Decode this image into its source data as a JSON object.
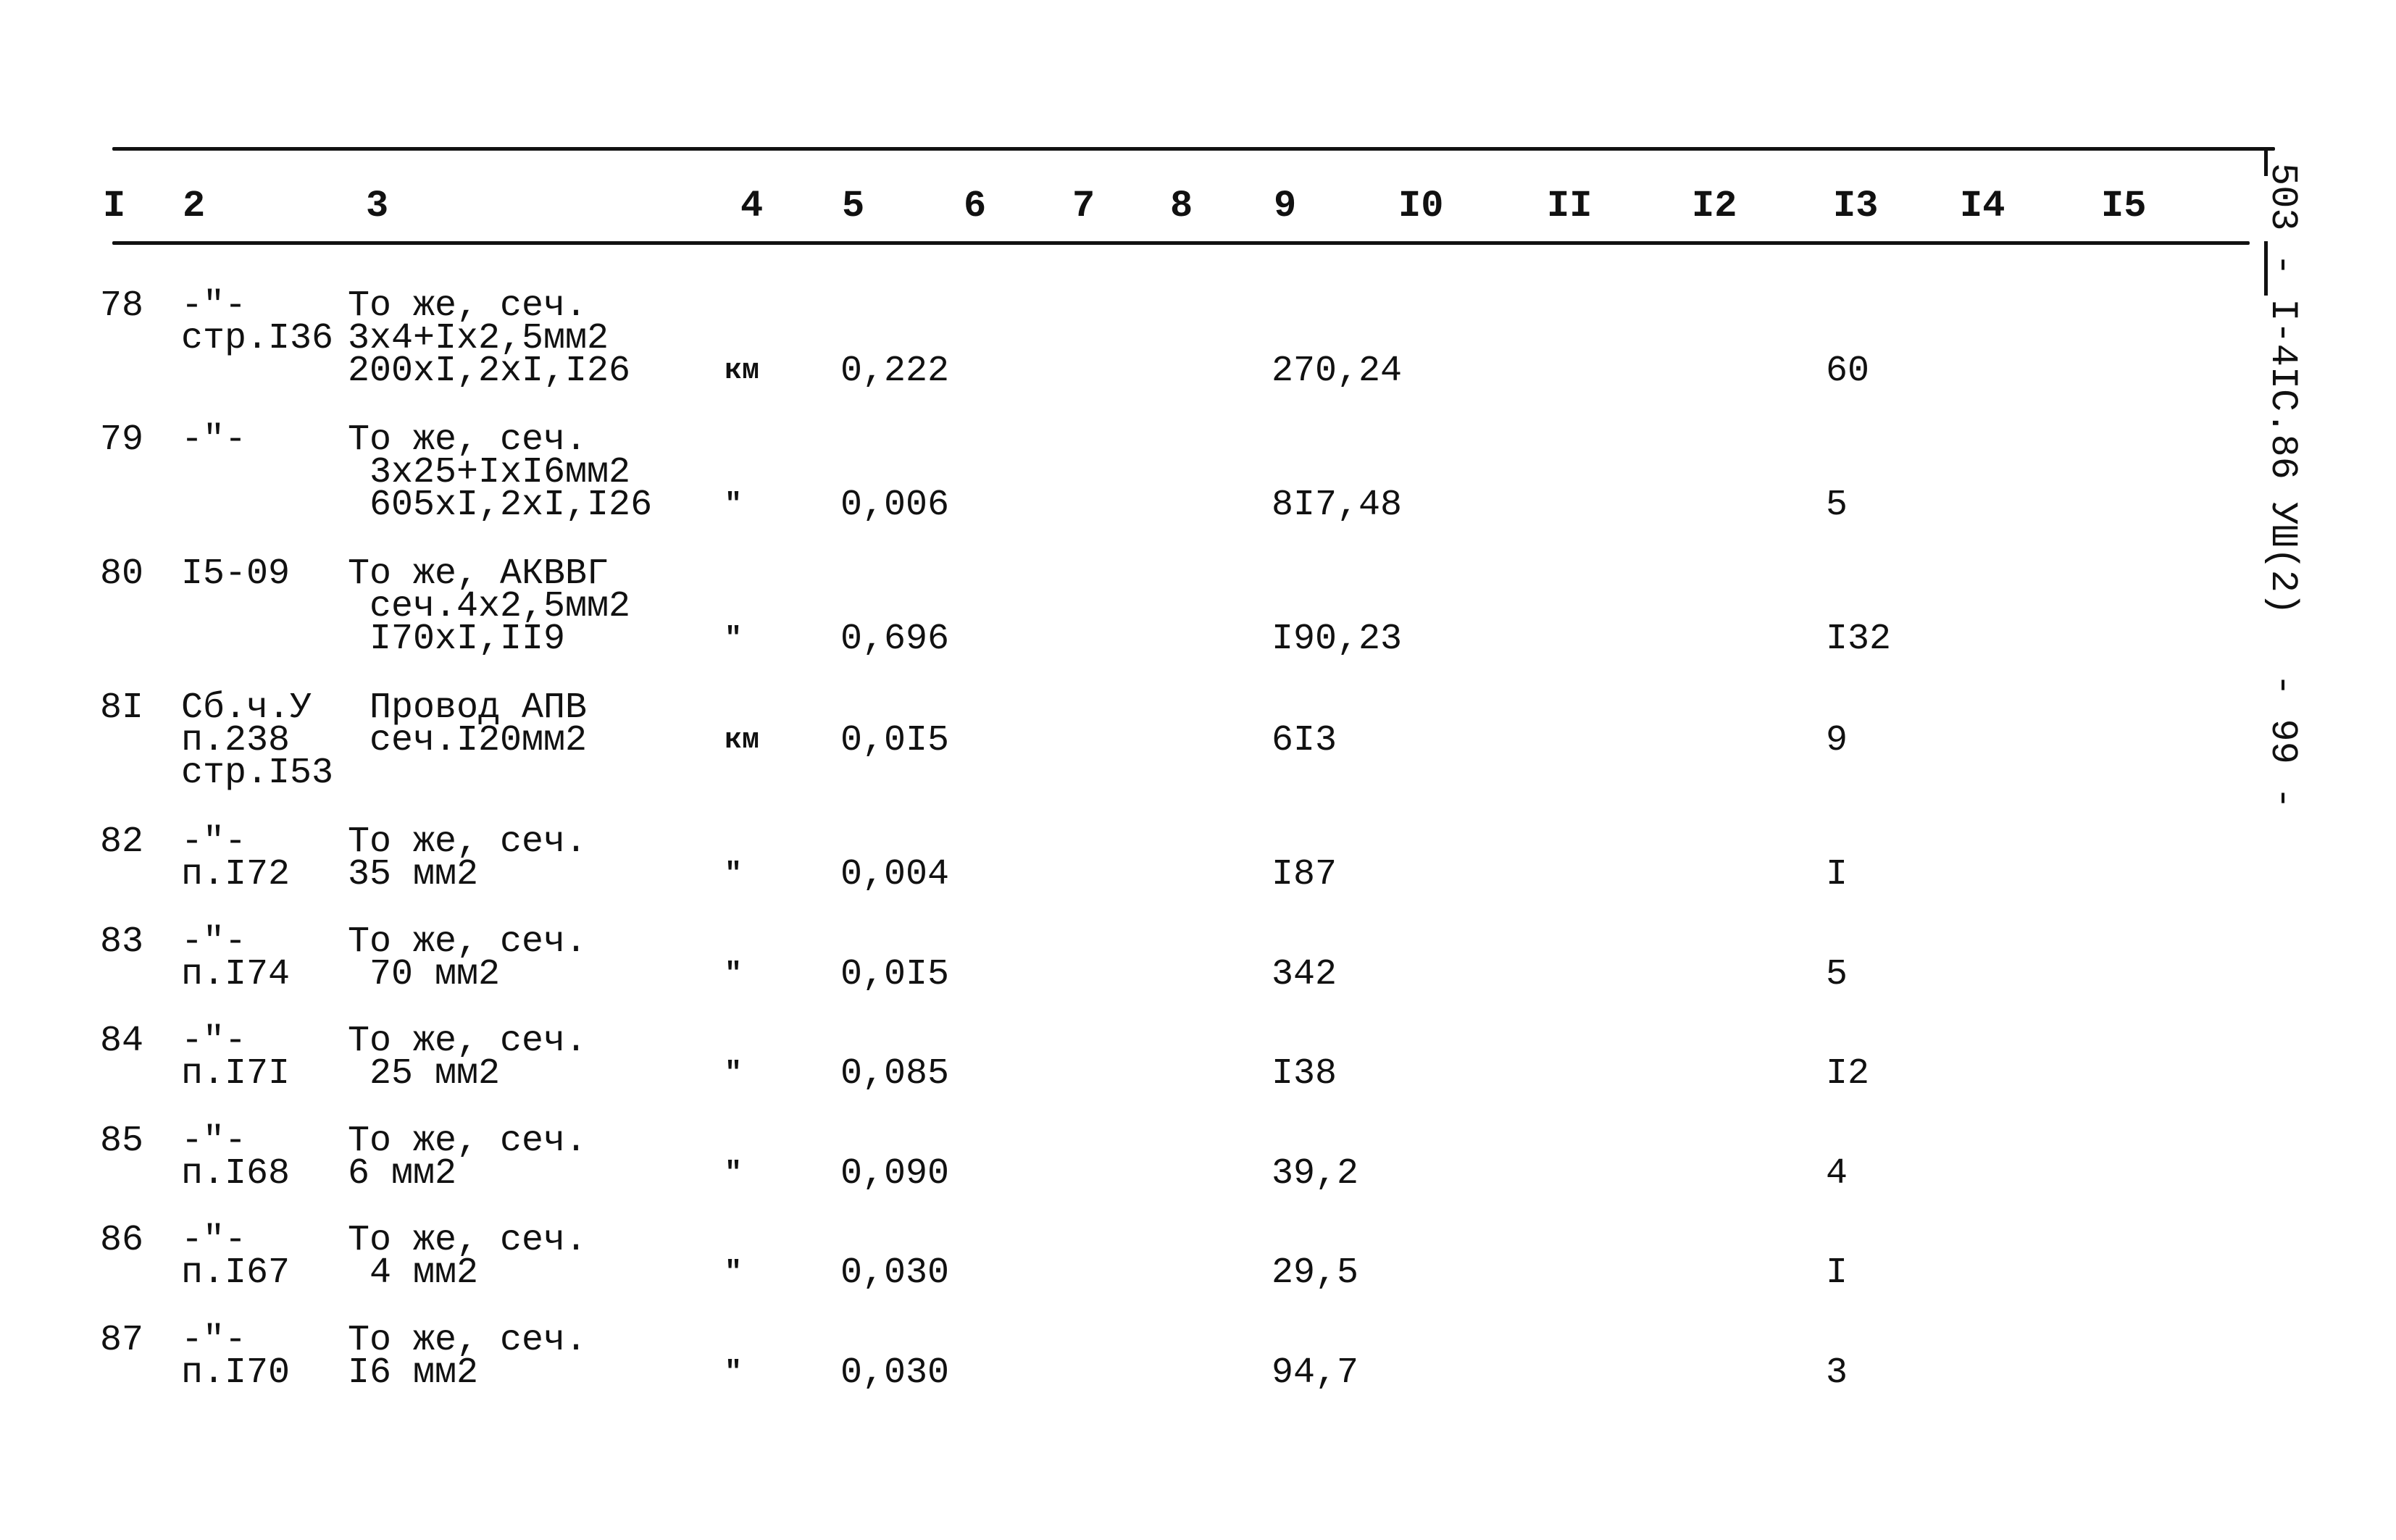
{
  "header": {
    "columns": [
      "I",
      "2",
      "3",
      "4",
      "5",
      "6",
      "7",
      "8",
      "9",
      "I0",
      "II",
      "I2",
      "I3",
      "I4",
      "I5"
    ]
  },
  "side_label": {
    "document_code": "503 - I-4IC.86 УШ(2)",
    "page_number": "- 99 -"
  },
  "rows": [
    {
      "num": "78",
      "ref": [
        "-\"-",
        "стр.I36"
      ],
      "desc": [
        "То же, сеч.",
        "3х4+Iх2,5мм2",
        "200хI,2хI,I26"
      ],
      "unit": "км",
      "qty": "0,222",
      "price": "270,24",
      "total": "60"
    },
    {
      "num": "79",
      "ref": [
        "-\"-"
      ],
      "desc": [
        "То же, сеч.",
        " 3х25+IхI6мм2",
        " 605хI,2хI,I26"
      ],
      "unit": "\"",
      "qty": "0,006",
      "price": "8I7,48",
      "total": "5"
    },
    {
      "num": "80",
      "ref": [
        "I5-09"
      ],
      "desc": [
        "То же, АКВВГ",
        " сеч.4х2,5мм2",
        " I70хI,II9"
      ],
      "unit": "\"",
      "qty": "0,696",
      "price": "I90,23",
      "total": "I32"
    },
    {
      "num": "8I",
      "ref": [
        "Сб.ч.У",
        "п.238",
        "стр.I53"
      ],
      "desc": [
        " Провод АПВ",
        " сеч.I20мм2"
      ],
      "unit": "км",
      "qty": "0,0I5",
      "price": "6I3",
      "total": "9"
    },
    {
      "num": "82",
      "ref": [
        "-\"-",
        "п.I72"
      ],
      "desc": [
        "То же, сеч.",
        "35 мм2"
      ],
      "unit": "\"",
      "qty": "0,004",
      "price": "I87",
      "total": "I"
    },
    {
      "num": "83",
      "ref": [
        "-\"-",
        "п.I74"
      ],
      "desc": [
        "То же, сеч.",
        " 70 мм2"
      ],
      "unit": "\"",
      "qty": "0,0I5",
      "price": "342",
      "total": "5"
    },
    {
      "num": "84",
      "ref": [
        "-\"-",
        "п.I7I"
      ],
      "desc": [
        "То же, сеч.",
        " 25 мм2"
      ],
      "unit": "\"",
      "qty": "0,085",
      "price": "I38",
      "total": "I2"
    },
    {
      "num": "85",
      "ref": [
        "-\"-",
        "п.I68"
      ],
      "desc": [
        "То же, сеч.",
        "6 мм2"
      ],
      "unit": "\"",
      "qty": "0,090",
      "price": "39,2",
      "total": "4"
    },
    {
      "num": "86",
      "ref": [
        "-\"-",
        "п.I67"
      ],
      "desc": [
        "То же, сеч.",
        " 4 мм2"
      ],
      "unit": "\"",
      "qty": "0,030",
      "price": "29,5",
      "total": "I"
    },
    {
      "num": "87",
      "ref": [
        "-\"-",
        "п.I70"
      ],
      "desc": [
        "То же, сеч.",
        "I6 мм2"
      ],
      "unit": "\"",
      "qty": "0,030",
      "price": "94,7",
      "total": "3"
    }
  ]
}
